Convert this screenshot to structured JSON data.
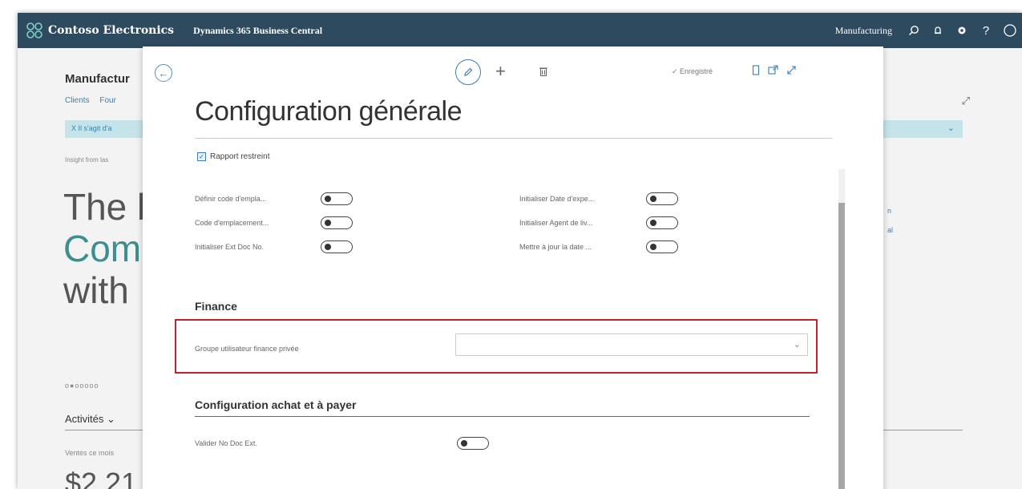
{
  "topbar": {
    "company": "Contoso Electronics",
    "product": "Dynamics 365 Business Central",
    "role": "Manufacturing",
    "icons": [
      "search-icon",
      "bell-icon",
      "gear-icon",
      "help-icon",
      "user-icon"
    ]
  },
  "background": {
    "page_title": "Manufactur",
    "nav_links": [
      "Clients",
      "Four"
    ],
    "notification": "X Il s'agit d'a",
    "insight": "Insight from las",
    "hero_lines": [
      "The b",
      "Com",
      "with"
    ],
    "pager": "o●ooooo",
    "activities": "Activités",
    "sales_label": "Ventes ce mois",
    "amount": "$2 21",
    "right_fragments": [
      "n",
      "al"
    ]
  },
  "dialog": {
    "title": "Configuration générale",
    "saved_status": "✓ Enregistré",
    "restricted_report": "Rapport restreint",
    "toggles": [
      {
        "label": "Définir code d'empla..."
      },
      {
        "label": "Code d'emplacement..."
      },
      {
        "label": "Initialiser Ext Doc No."
      },
      {
        "label": "Initialiser Date d'expe..."
      },
      {
        "label": "Initialiser Agent de liv..."
      },
      {
        "label": "Mettre à jour la date ..."
      }
    ],
    "finance": {
      "heading": "Finance",
      "field_label": "Groupe utilisateur finance privée",
      "field_value": ""
    },
    "purchase": {
      "heading": "Configuration achat et à payer",
      "field_label": "Valider No Doc Ext."
    }
  },
  "colors": {
    "topbar": "#2e4a5f",
    "accent": "#3b7fb0",
    "highlight": "#c9202e"
  }
}
